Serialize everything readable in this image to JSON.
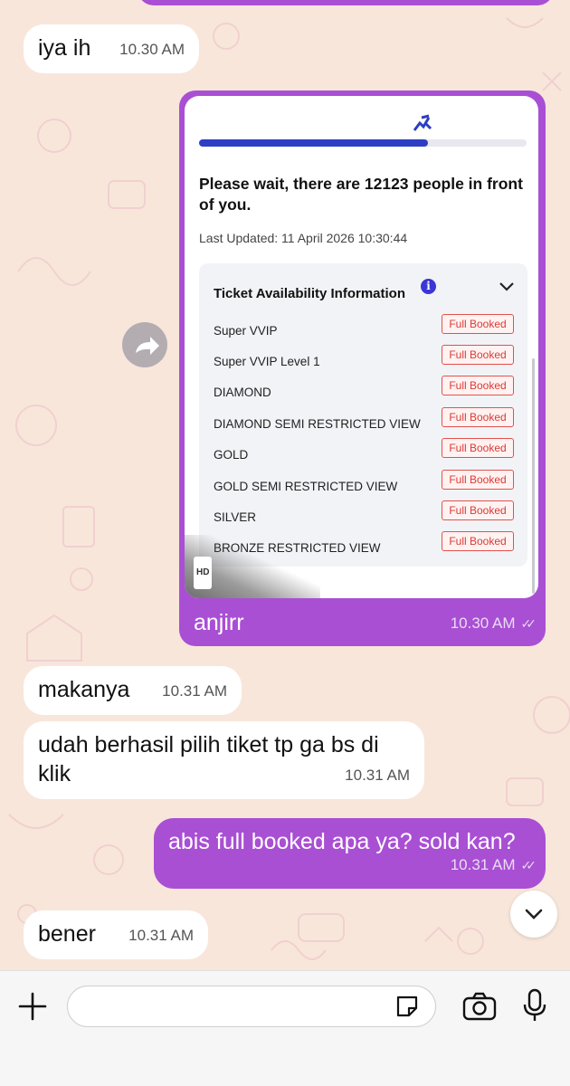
{
  "theme": {
    "bubble_out": "#a94fd4",
    "bubble_in": "#ffffff",
    "wallpaper": "#f8e6db"
  },
  "messages": [
    {
      "id": "m1",
      "dir": "in",
      "text": "iya ih",
      "time": "10.30 AM"
    },
    {
      "id": "m2",
      "dir": "out",
      "caption": "anjirr",
      "time": "10.30 AM",
      "shot": {
        "progress": 0.7,
        "wait_text": "Please wait, there are 12123 people in front of you.",
        "updated": "Last Updated: 11 April 2026 10:30:44",
        "panel_title": "Ticket Availability Information",
        "info_icon": "info-icon",
        "hd_label": "HD",
        "rows": [
          {
            "name": "Super VVIP",
            "status": "Full Booked"
          },
          {
            "name": "Super VVIP Level 1",
            "status": "Full Booked"
          },
          {
            "name": "DIAMOND",
            "status": "Full Booked"
          },
          {
            "name": "DIAMOND SEMI RESTRICTED VIEW",
            "status": "Full Booked"
          },
          {
            "name": "GOLD",
            "status": "Full Booked"
          },
          {
            "name": "GOLD SEMI RESTRICTED VIEW",
            "status": "Full Booked"
          },
          {
            "name": "SILVER",
            "status": "Full Booked"
          },
          {
            "name": "BRONZE RESTRICTED VIEW",
            "status": "Full Booked"
          }
        ]
      }
    },
    {
      "id": "m3",
      "dir": "in",
      "text": "makanya",
      "time": "10.31 AM"
    },
    {
      "id": "m4",
      "dir": "in",
      "text": "udah berhasil pilih tiket tp ga bs di klik",
      "time": "10.31 AM"
    },
    {
      "id": "m5",
      "dir": "out",
      "text": "abis full booked apa ya? sold kan?",
      "time": "10.31 AM"
    },
    {
      "id": "m6",
      "dir": "in",
      "text": "bener",
      "time": "10.31 AM"
    }
  ],
  "composer": {
    "value": "",
    "placeholder": ""
  }
}
